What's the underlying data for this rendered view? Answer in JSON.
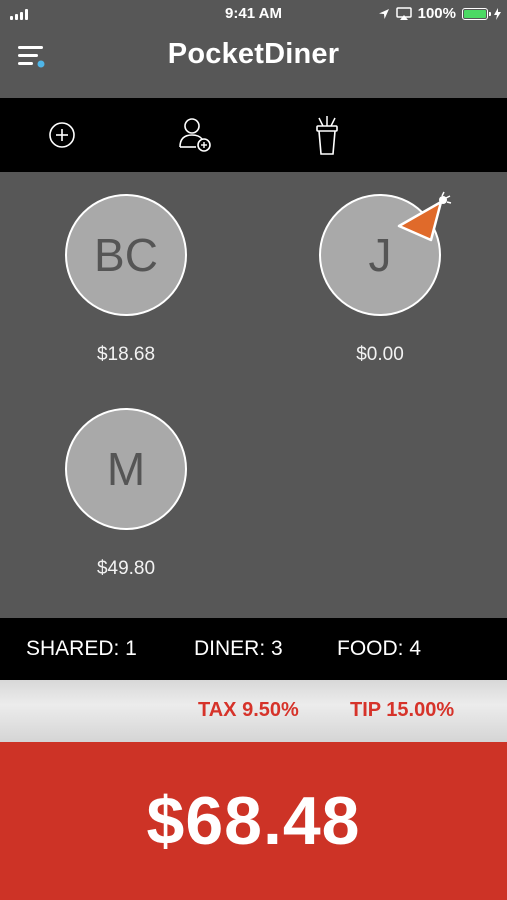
{
  "status_bar": {
    "time": "9:41 AM",
    "battery": "100%"
  },
  "header": {
    "title": "PocketDiner"
  },
  "toolbar": {
    "icons": [
      "add-circle-icon",
      "add-person-icon",
      "drink-cup-icon"
    ]
  },
  "diners": [
    {
      "initials": "BC",
      "amount": "$18.68"
    },
    {
      "initials": "J",
      "amount": "$0.00",
      "badge": "party-hat-icon"
    },
    {
      "initials": "M",
      "amount": "$49.80"
    }
  ],
  "counts": {
    "shared": "SHARED: 1",
    "diner": "DINER: 3",
    "food": "FOOD: 4"
  },
  "rates": {
    "tax": "TAX 9.50%",
    "tip": "TIP 15.00%"
  },
  "total": {
    "amount": "$68.48"
  },
  "colors": {
    "background": "#575757",
    "accent_red": "#cd3326",
    "rate_text": "#d6332a",
    "menu_dot": "#4fb6e8",
    "hat": "#e06a2a"
  }
}
